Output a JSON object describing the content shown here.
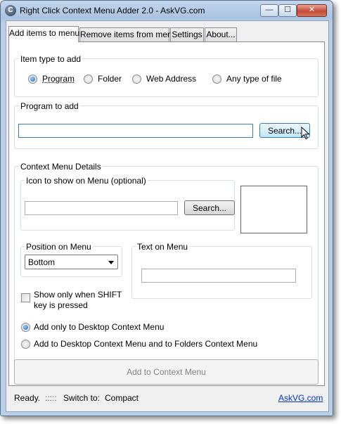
{
  "window": {
    "title": "Right Click Context Menu Adder 2.0  -  AskVG.com",
    "app_icon_glyph": "C",
    "controls": {
      "minimize": "—",
      "maximize": "☐",
      "close": "✕"
    }
  },
  "tabs": [
    {
      "label": "Add items to menu",
      "active": true
    },
    {
      "label": "Remove items from menu",
      "active": false
    },
    {
      "label": "Settings",
      "active": false
    },
    {
      "label": "About...",
      "active": false
    }
  ],
  "item_type": {
    "label": "Item type to add",
    "options": [
      {
        "label": "Program",
        "checked": true
      },
      {
        "label": "Folder",
        "checked": false
      },
      {
        "label": "Web Address",
        "checked": false
      },
      {
        "label": "Any type of file",
        "checked": false
      }
    ]
  },
  "program": {
    "label": "Program to add",
    "path_value": "",
    "search_label": "Search..."
  },
  "details": {
    "label": "Context Menu Details",
    "icon_group_label": "Icon to show on Menu (optional)",
    "icon_path_value": "",
    "icon_search_label": "Search...",
    "position_label": "Position on Menu",
    "position_value": "Bottom",
    "text_label": "Text on Menu",
    "text_value": "",
    "shift_label_line1": "Show only when SHIFT",
    "shift_label_line2": "key is pressed",
    "shift_checked": false,
    "scope_options": [
      {
        "label": "Add only to Desktop Context Menu",
        "checked": true
      },
      {
        "label": "Add to Desktop Context Menu and to Folders Context Menu",
        "checked": false
      }
    ]
  },
  "add_button": "Add to Context Menu",
  "status": {
    "text": "Ready.",
    "grip": ":::::",
    "switch_label": "Switch to:",
    "switch_target": "Compact",
    "link": "AskVG.com"
  },
  "colors": {
    "link": "#0033cc",
    "title_bar": "#b9cfe8",
    "radio_checked": "#1a5fb4"
  },
  "icons": [
    "app-icon",
    "minimize-icon",
    "maximize-icon",
    "close-icon",
    "dropdown-arrow-icon",
    "mouse-pointer-icon"
  ]
}
